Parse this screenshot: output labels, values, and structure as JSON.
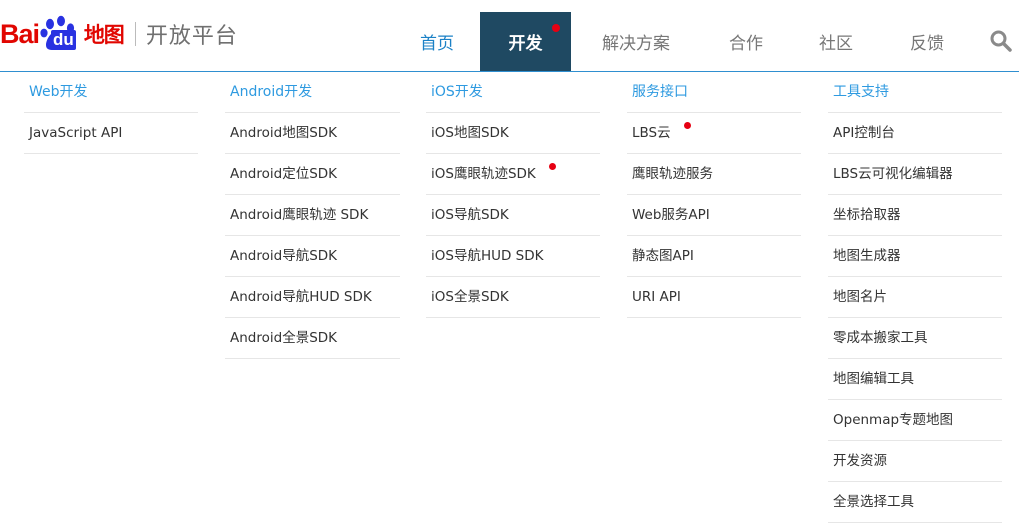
{
  "logo": {
    "bai": "Bai",
    "du": "du",
    "ditu": "地图",
    "platform": "开放平台"
  },
  "nav": {
    "home": "首页",
    "develop": "开发",
    "solutions": "解决方案",
    "cooperation": "合作",
    "community": "社区",
    "feedback": "反馈",
    "search_icon": "magnifier"
  },
  "menu": {
    "web": {
      "title": "Web开发",
      "items": [
        "JavaScript API"
      ]
    },
    "android": {
      "title": "Android开发",
      "items": [
        "Android地图SDK",
        "Android定位SDK",
        "Android鹰眼轨迹 SDK",
        "Android导航SDK",
        "Android导航HUD SDK",
        "Android全景SDK"
      ]
    },
    "ios": {
      "title": "iOS开发",
      "items": [
        "iOS地图SDK",
        "iOS鹰眼轨迹SDK",
        "iOS导航SDK",
        "iOS导航HUD SDK",
        "iOS全景SDK"
      ]
    },
    "service": {
      "title": "服务接口",
      "items": [
        "LBS云",
        "鹰眼轨迹服务",
        "Web服务API",
        "静态图API",
        "URI API"
      ]
    },
    "tools": {
      "title": "工具支持",
      "items": [
        "API控制台",
        "LBS云可视化编辑器",
        "坐标拾取器",
        "地图生成器",
        "地图名片",
        "零成本搬家工具",
        "地图编辑工具",
        "Openmap专题地图",
        "开发资源",
        "全景选择工具"
      ]
    }
  },
  "colors": {
    "accent_blue": "#2e9ae0",
    "nav_active_bg": "#1f4962",
    "brand_red": "#e10601",
    "brand_blue": "#2932e1",
    "notification_dot": "#e60012"
  }
}
